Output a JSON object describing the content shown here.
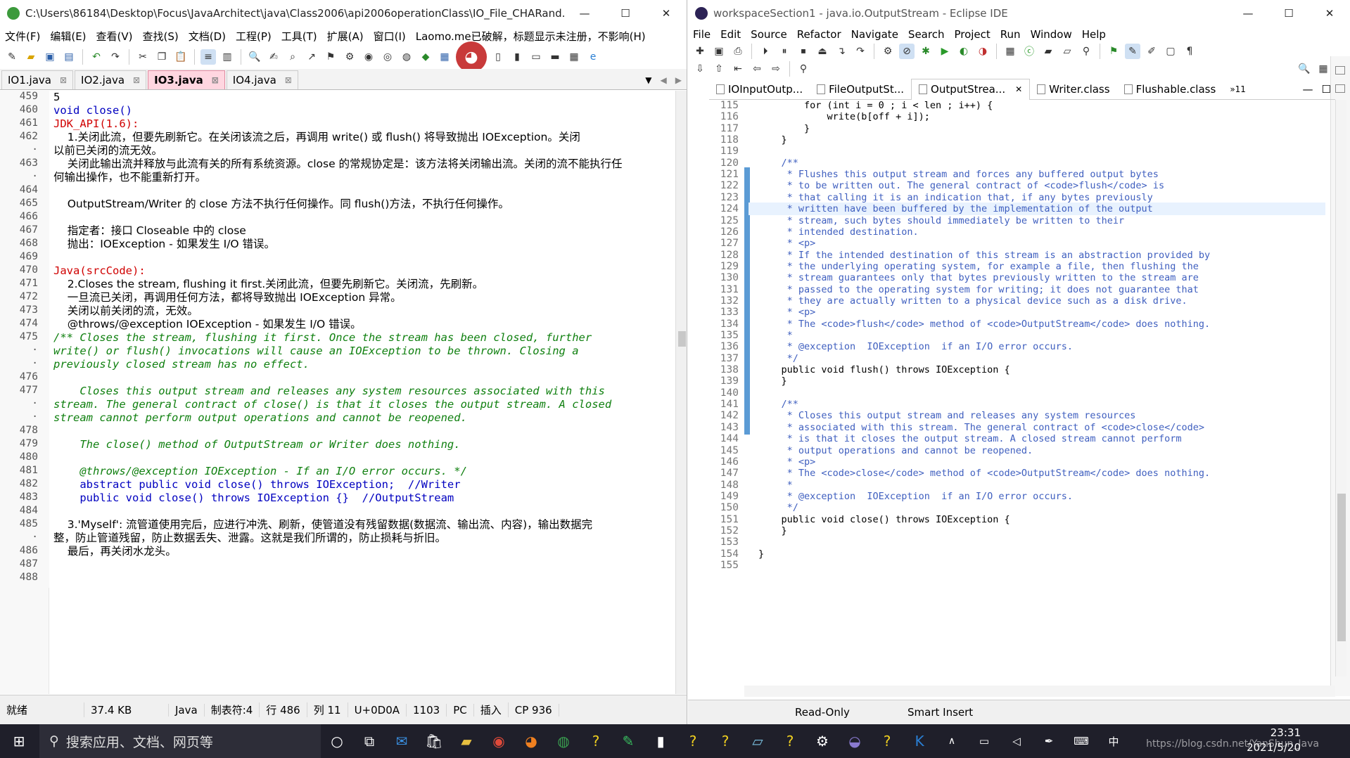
{
  "left": {
    "title": "C:\\Users\\86184\\Desktop\\Focus\\JavaArchitect\\java\\Class2006\\api2006operationClass\\IO_File_CHARand...",
    "menu": [
      "文件(F)",
      "编辑(E)",
      "查看(V)",
      "查找(S)",
      "文档(D)",
      "工程(P)",
      "工具(T)",
      "扩展(A)",
      "窗口(I)",
      "Laomo.me已破解，标题显示未注册，不影响(H)"
    ],
    "tabs": [
      "IO1.java",
      "IO2.java",
      "IO3.java",
      "IO4.java"
    ],
    "active_tab": "IO3.java",
    "lines": [
      {
        "n": "459",
        "t": "5"
      },
      {
        "n": "460",
        "t": "void close()"
      },
      {
        "n": "461",
        "t": "JDK_API(1.6):"
      },
      {
        "n": "462",
        "t": "    1.关闭此流，但要先刷新它。在关闭该流之后，再调用 write() 或 flush() 将导致抛出 IOException。关闭"
      },
      {
        "n": "·",
        "t": "以前已关闭的流无效。"
      },
      {
        "n": "463",
        "t": "    关闭此输出流并释放与此流有关的所有系统资源。close 的常规协定是：该方法将关闭输出流。关闭的流不能执行任"
      },
      {
        "n": "·",
        "t": "何输出操作，也不能重新打开。"
      },
      {
        "n": "464",
        "t": ""
      },
      {
        "n": "465",
        "t": "    OutputStream/Writer 的 close 方法不执行任何操作。同 flush()方法，不执行任何操作。"
      },
      {
        "n": "466",
        "t": ""
      },
      {
        "n": "467",
        "t": "    指定者：接口 Closeable 中的 close"
      },
      {
        "n": "468",
        "t": "    抛出：IOException - 如果发生 I/O 错误。"
      },
      {
        "n": "469",
        "t": ""
      },
      {
        "n": "470",
        "t": "Java(srcCode):"
      },
      {
        "n": "471",
        "t": "    2.Closes the stream, flushing it first.关闭此流，但要先刷新它。关闭流，先刷新。"
      },
      {
        "n": "472",
        "t": "    一旦流已关闭，再调用任何方法，都将导致抛出 IOException 异常。"
      },
      {
        "n": "473",
        "t": "    关闭以前关闭的流，无效。"
      },
      {
        "n": "474",
        "t": "    @throws/@exception IOException - 如果发生 I/O 错误。"
      },
      {
        "n": "475",
        "t": "/** Closes the stream, flushing it first. Once the stream has been closed, further"
      },
      {
        "n": "·",
        "t": "write() or flush() invocations will cause an IOException to be thrown. Closing a"
      },
      {
        "n": "·",
        "t": "previously closed stream has no effect."
      },
      {
        "n": "476",
        "t": ""
      },
      {
        "n": "477",
        "t": "    Closes this output stream and releases any system resources associated with this"
      },
      {
        "n": "·",
        "t": "stream. The general contract of close() is that it closes the output stream. A closed"
      },
      {
        "n": "·",
        "t": "stream cannot perform output operations and cannot be reopened."
      },
      {
        "n": "478",
        "t": ""
      },
      {
        "n": "479",
        "t": "    The close() method of OutputStream or Writer does nothing."
      },
      {
        "n": "480",
        "t": ""
      },
      {
        "n": "481",
        "t": "    @throws/@exception IOException - If an I/O error occurs. */"
      },
      {
        "n": "482",
        "t": "    abstract public void close() throws IOException;  //Writer"
      },
      {
        "n": "483",
        "t": "    public void close() throws IOException {}  //OutputStream"
      },
      {
        "n": "484",
        "t": ""
      },
      {
        "n": "485",
        "t": "    3.'Myself': 流管道使用完后，应进行冲洗、刷新，使管道没有残留数据(数据流、输出流、内容)，输出数据完"
      },
      {
        "n": "·",
        "t": "整，防止管道残留，防止数据丢失、泄露。这就是我们所谓的，防止损耗与折旧。"
      },
      {
        "n": "486",
        "t": "    最后，再关闭水龙头。"
      },
      {
        "n": "487",
        "t": ""
      },
      {
        "n": "488",
        "t": ""
      }
    ],
    "status": [
      "就绪",
      "37.4 KB",
      "Java",
      "制表符:4",
      "行 486",
      "列 11",
      "U+0D0A",
      "1103",
      "PC",
      "插入",
      "CP 936"
    ]
  },
  "right": {
    "title": "workspaceSection1 - java.io.OutputStream - Eclipse IDE",
    "menu": [
      "File",
      "Edit",
      "Source",
      "Refactor",
      "Navigate",
      "Search",
      "Project",
      "Run",
      "Window",
      "Help"
    ],
    "tabs": [
      "IOInputOutp...",
      "FileOutputSt...",
      "OutputStrea...",
      "Writer.class",
      "Flushable.class",
      "»11"
    ],
    "active_tab": "OutputStrea...",
    "lines": [
      {
        "n": "115",
        "t": "        for (int i = 0 ; i < len ; i++) {"
      },
      {
        "n": "116",
        "t": "            write(b[off + i]);"
      },
      {
        "n": "117",
        "t": "        }"
      },
      {
        "n": "118",
        "t": "    }"
      },
      {
        "n": "119",
        "t": ""
      },
      {
        "n": "120",
        "t": "    /**"
      },
      {
        "n": "121",
        "t": "     * Flushes this output stream and forces any buffered output bytes"
      },
      {
        "n": "122",
        "t": "     * to be written out. The general contract of <code>flush</code> is"
      },
      {
        "n": "123",
        "t": "     * that calling it is an indication that, if any bytes previously"
      },
      {
        "n": "124",
        "t": "     * written have been buffered by the implementation of the output"
      },
      {
        "n": "125",
        "t": "     * stream, such bytes should immediately be written to their"
      },
      {
        "n": "126",
        "t": "     * intended destination."
      },
      {
        "n": "127",
        "t": "     * <p>"
      },
      {
        "n": "128",
        "t": "     * If the intended destination of this stream is an abstraction provided by"
      },
      {
        "n": "129",
        "t": "     * the underlying operating system, for example a file, then flushing the"
      },
      {
        "n": "130",
        "t": "     * stream guarantees only that bytes previously written to the stream are"
      },
      {
        "n": "131",
        "t": "     * passed to the operating system for writing; it does not guarantee that"
      },
      {
        "n": "132",
        "t": "     * they are actually written to a physical device such as a disk drive."
      },
      {
        "n": "133",
        "t": "     * <p>"
      },
      {
        "n": "134",
        "t": "     * The <code>flush</code> method of <code>OutputStream</code> does nothing."
      },
      {
        "n": "135",
        "t": "     *"
      },
      {
        "n": "136",
        "t": "     * @exception  IOException  if an I/O error occurs."
      },
      {
        "n": "137",
        "t": "     */"
      },
      {
        "n": "138",
        "t": "    public void flush() throws IOException {"
      },
      {
        "n": "139",
        "t": "    }"
      },
      {
        "n": "140",
        "t": ""
      },
      {
        "n": "141",
        "t": "    /**"
      },
      {
        "n": "142",
        "t": "     * Closes this output stream and releases any system resources"
      },
      {
        "n": "143",
        "t": "     * associated with this stream. The general contract of <code>close</code>"
      },
      {
        "n": "144",
        "t": "     * is that it closes the output stream. A closed stream cannot perform"
      },
      {
        "n": "145",
        "t": "     * output operations and cannot be reopened."
      },
      {
        "n": "146",
        "t": "     * <p>"
      },
      {
        "n": "147",
        "t": "     * The <code>close</code> method of <code>OutputStream</code> does nothing."
      },
      {
        "n": "148",
        "t": "     *"
      },
      {
        "n": "149",
        "t": "     * @exception  IOException  if an I/O error occurs."
      },
      {
        "n": "150",
        "t": "     */"
      },
      {
        "n": "151",
        "t": "    public void close() throws IOException {"
      },
      {
        "n": "152",
        "t": "    }"
      },
      {
        "n": "153",
        "t": ""
      },
      {
        "n": "154",
        "t": "}"
      },
      {
        "n": "155",
        "t": ""
      }
    ],
    "status": {
      "mode": "Read-Only",
      "insert": "Smart Insert"
    }
  },
  "taskbar": {
    "search_placeholder": "搜索应用、文档、网页等",
    "time": "23:31",
    "date": "2021/5/20",
    "watermark": "https://blog.csdn.net/YanShun_Java"
  }
}
